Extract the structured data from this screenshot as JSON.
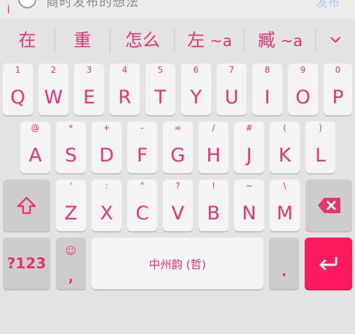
{
  "composing_bar": {
    "cursor": "i",
    "text": "商时发布的想法",
    "publish_label": "发布"
  },
  "candidates": [
    {
      "text": "在",
      "suffix": ""
    },
    {
      "text": "重",
      "suffix": ""
    },
    {
      "text": "怎么",
      "suffix": ""
    },
    {
      "text": "左",
      "suffix": " ~a"
    },
    {
      "text": "臧",
      "suffix": " ~a"
    }
  ],
  "row1": [
    {
      "letter": "Q",
      "hint": "1"
    },
    {
      "letter": "W",
      "hint": "2"
    },
    {
      "letter": "E",
      "hint": "3"
    },
    {
      "letter": "R",
      "hint": "4"
    },
    {
      "letter": "T",
      "hint": "5"
    },
    {
      "letter": "Y",
      "hint": "6"
    },
    {
      "letter": "U",
      "hint": "7"
    },
    {
      "letter": "I",
      "hint": "8"
    },
    {
      "letter": "O",
      "hint": "9"
    },
    {
      "letter": "P",
      "hint": "0"
    }
  ],
  "row2": [
    {
      "letter": "A",
      "hint": "@"
    },
    {
      "letter": "S",
      "hint": "*"
    },
    {
      "letter": "D",
      "hint": "+"
    },
    {
      "letter": "F",
      "hint": "-"
    },
    {
      "letter": "G",
      "hint": "="
    },
    {
      "letter": "H",
      "hint": "/"
    },
    {
      "letter": "J",
      "hint": "#"
    },
    {
      "letter": "K",
      "hint": "("
    },
    {
      "letter": "L",
      "hint": ")"
    }
  ],
  "row3": [
    {
      "letter": "Z",
      "hint": "'"
    },
    {
      "letter": "X",
      "hint": ":"
    },
    {
      "letter": "C",
      "hint": "\""
    },
    {
      "letter": "V",
      "hint": "?"
    },
    {
      "letter": "B",
      "hint": "!"
    },
    {
      "letter": "N",
      "hint": "~"
    },
    {
      "letter": "M",
      "hint": "\\"
    }
  ],
  "bottom_row": {
    "symbols_label": "?123",
    "comma_hint": "☺",
    "comma_label": ",",
    "space_label": "中州韵 (哲)",
    "period_label": "."
  },
  "icons": {
    "shift": "shift-icon",
    "backspace": "backspace-icon",
    "enter": "enter-icon",
    "expand": "chevron-down-icon"
  },
  "colors": {
    "accent": "#e8336f",
    "enter_bg": "#ff1a5d",
    "key_bg": "#f4f4f4",
    "func_key_bg": "#cdcdcd",
    "keyboard_bg": "#e3e3e3"
  }
}
